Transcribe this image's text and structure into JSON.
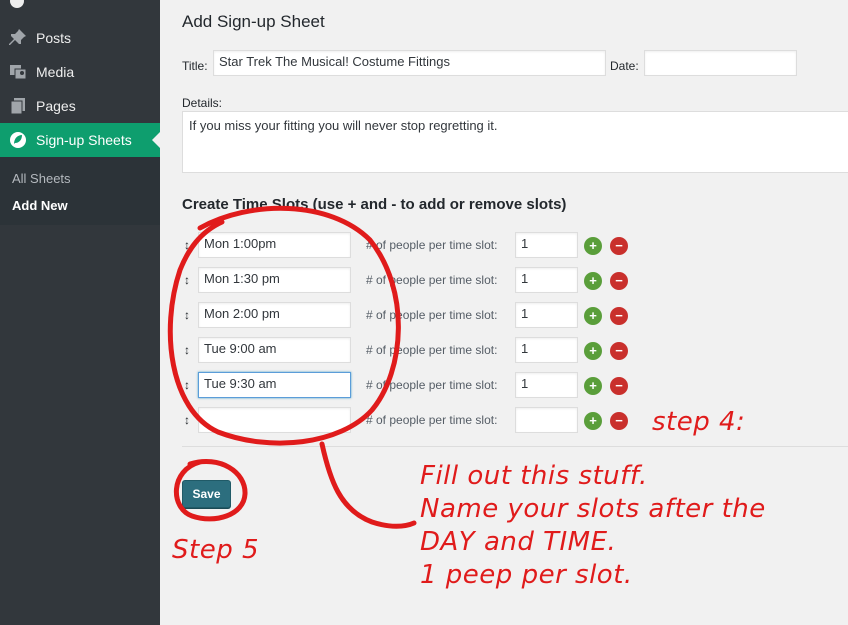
{
  "sidebar": {
    "items": [
      {
        "label": "Posts",
        "icon": "pushpin-icon"
      },
      {
        "label": "Media",
        "icon": "media-icon"
      },
      {
        "label": "Pages",
        "icon": "pages-icon"
      },
      {
        "label": "Sign-up Sheets",
        "icon": "signup-leaf-icon"
      }
    ],
    "submenu": [
      {
        "label": "All Sheets"
      },
      {
        "label": "Add New"
      }
    ],
    "active_color": "#0e9e6e",
    "bg_color": "#32373c"
  },
  "form": {
    "page_title": "Add Sign-up Sheet",
    "title_label": "Title:",
    "title_value": "Star Trek The Musical! Costume Fittings",
    "date_label": "Date:",
    "date_value": "",
    "details_label": "Details:",
    "details_value": "If you miss your fitting you will never stop regretting it.",
    "slots_heading": "Create Time Slots (use + and - to add or remove slots)",
    "people_label": "# of people per time slot:",
    "slots": [
      {
        "name": "Mon 1:00pm",
        "count": "1"
      },
      {
        "name": "Mon 1:30 pm",
        "count": "1"
      },
      {
        "name": "Mon 2:00 pm",
        "count": "1"
      },
      {
        "name": "Tue 9:00 am",
        "count": "1"
      },
      {
        "name": "Tue 9:30 am",
        "count": "1"
      },
      {
        "name": "",
        "count": ""
      }
    ],
    "add_symbol": "+",
    "remove_symbol": "−",
    "save_label": "Save"
  },
  "annotations": {
    "step4": "step 4:",
    "step5": "Step 5",
    "instructions": [
      "Fill out this stuff.",
      "Name your slots after the",
      "DAY and TIME.",
      "1 peep per slot."
    ],
    "color": "#e01b1b"
  }
}
